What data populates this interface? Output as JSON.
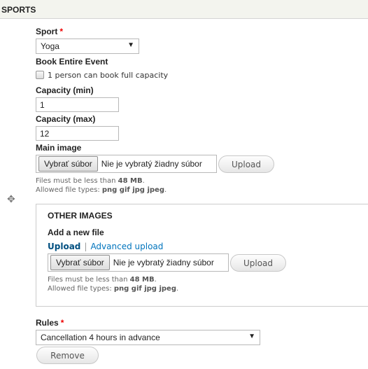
{
  "section": {
    "title": "SPORTS"
  },
  "sport": {
    "label": "Sport",
    "required_mark": "*",
    "value": "Yoga",
    "arrow": "▼"
  },
  "book_entire": {
    "label": "Book Entire Event",
    "checkbox_label": "1 person can book full capacity",
    "checked": false
  },
  "capacity_min": {
    "label": "Capacity (min)",
    "value": "1"
  },
  "capacity_max": {
    "label": "Capacity (max)",
    "value": "12"
  },
  "main_image": {
    "label": "Main image",
    "choose_button": "Vybrať súbor",
    "no_file_text": "Nie je vybratý žiadny súbor",
    "upload_button": "Upload",
    "size_prefix": "Files must be less than ",
    "size_value": "48 MB",
    "size_suffix": ".",
    "types_prefix": "Allowed file types: ",
    "types_value": "png gif jpg jpeg",
    "types_suffix": "."
  },
  "drag_handle": {
    "icon": "move-icon",
    "glyph": "✥"
  },
  "other_images": {
    "title": "OTHER IMAGES",
    "add_label": "Add a new file",
    "upload_link": "Upload",
    "separator": "|",
    "advanced_link": "Advanced upload",
    "choose_button": "Vybrať súbor",
    "no_file_text": "Nie je vybratý žiadny súbor",
    "upload_button": "Upload",
    "size_prefix": "Files must be less than ",
    "size_value": "48 MB",
    "size_suffix": ".",
    "types_prefix": "Allowed file types: ",
    "types_value": "png gif jpg jpeg",
    "types_suffix": "."
  },
  "rules": {
    "label": "Rules",
    "required_mark": "*",
    "value": "Cancellation 4 hours in advance",
    "arrow": "▼",
    "remove_button": "Remove"
  },
  "colors": {
    "required": "#ee0000",
    "link": "#0074bd",
    "header_bg": "#f3f4ee"
  }
}
